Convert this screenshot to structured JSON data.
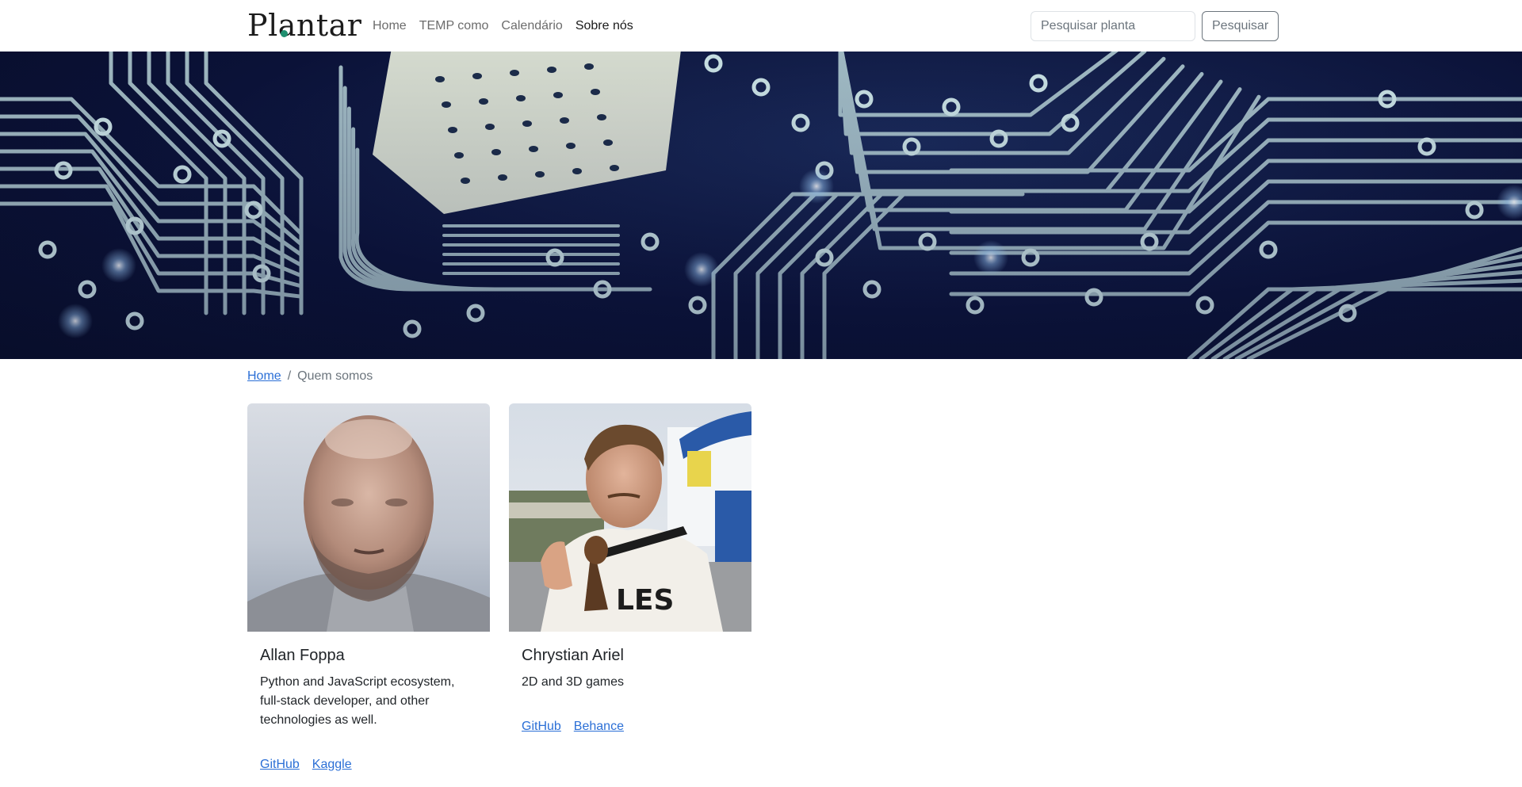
{
  "nav": {
    "brand": "Plantar",
    "links": [
      {
        "label": "Home"
      },
      {
        "label": "TEMP como"
      },
      {
        "label": "Calendário"
      },
      {
        "label": "Sobre nós"
      }
    ],
    "search_placeholder": "Pesquisar planta",
    "search_button": "Pesquisar"
  },
  "breadcrumb": {
    "home": "Home",
    "separator": "/",
    "current": "Quem somos"
  },
  "team": [
    {
      "name": "Allan Foppa",
      "description": "Python and JavaScript ecosystem, full-stack developer, and other technologies as well.",
      "links": [
        "GitHub",
        "Kaggle"
      ]
    },
    {
      "name": "Chrystian Ariel",
      "description": "2D and 3D games",
      "links": [
        "GitHub",
        "Behance"
      ]
    }
  ],
  "colors": {
    "link": "#2b6fd6",
    "hero_bg": "#0b1238",
    "trace": "#b8d4d8",
    "brand_dot": "#1f8f6f"
  }
}
